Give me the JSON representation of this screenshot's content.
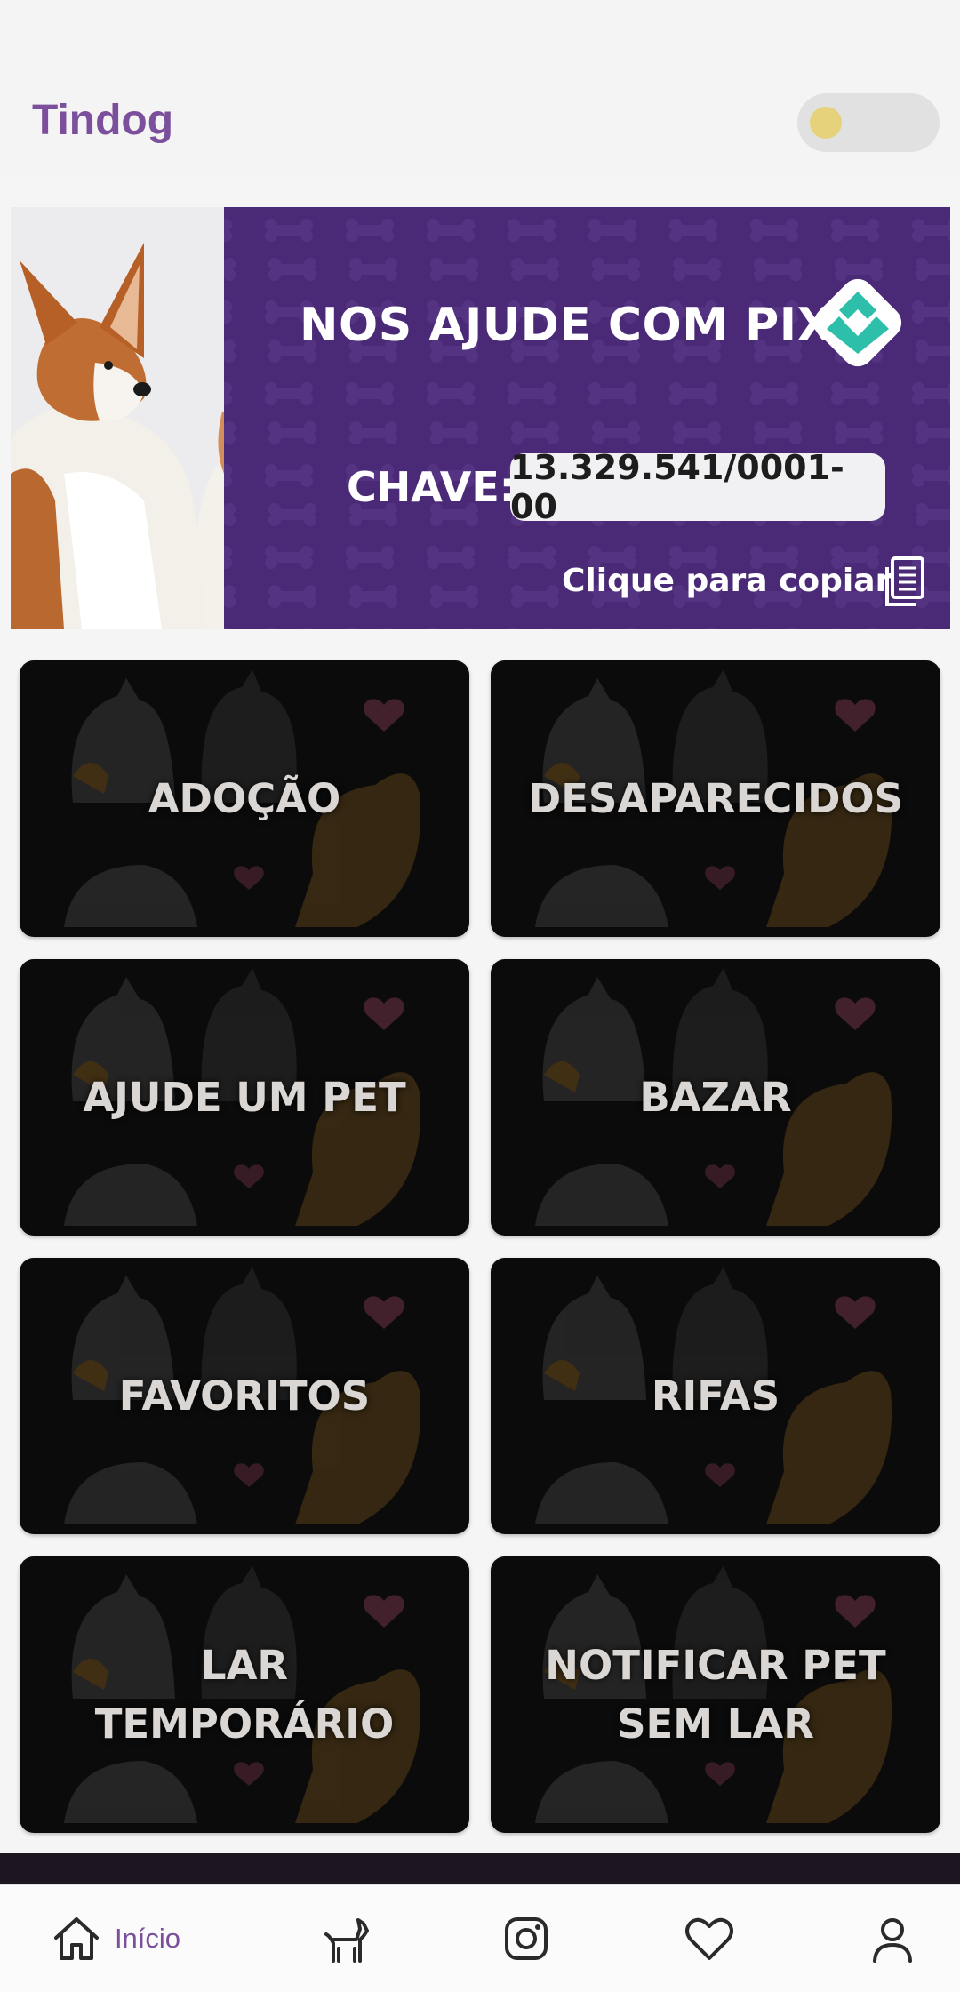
{
  "app": {
    "title": "Tindog"
  },
  "theme_toggle": {
    "knob_color": "#e6d27a",
    "track_color": "#e1e1e1"
  },
  "pix_banner": {
    "title": "NOS AJUDE COM PIX!",
    "key_label": "CHAVE:",
    "key_value": "13.329.541/0001-00",
    "copy_hint": "Clique para copiar",
    "icons": [
      "dog-photo",
      "pix-logo",
      "copy-icon"
    ],
    "background_color": "#4a2a76",
    "pix_color": "#2ebfab"
  },
  "tiles": [
    {
      "label": "ADOÇÃO"
    },
    {
      "label": "DESAPARECIDOS"
    },
    {
      "label": "AJUDE UM PET"
    },
    {
      "label": "BAZAR"
    },
    {
      "label": "FAVORITOS"
    },
    {
      "label": "RIFAS"
    },
    {
      "label": "LAR TEMPORÁRIO"
    },
    {
      "label": "NOTIFICAR PET SEM LAR"
    }
  ],
  "bottom_nav": {
    "items": [
      {
        "icon": "home-icon",
        "label": "Início",
        "active": true
      },
      {
        "icon": "dog-icon",
        "active": false
      },
      {
        "icon": "instagram-icon",
        "active": false
      },
      {
        "icon": "heart-icon",
        "active": false
      },
      {
        "icon": "profile-icon",
        "active": false
      }
    ],
    "accent_color": "#7b4f9c"
  }
}
